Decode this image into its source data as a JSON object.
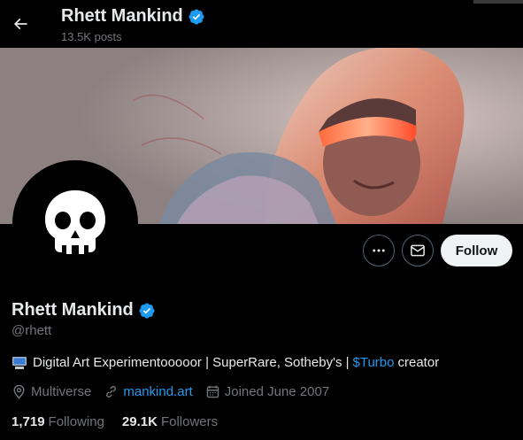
{
  "header": {
    "name": "Rhett Mankind",
    "posts": "13.5K posts"
  },
  "profile": {
    "name": "Rhett Mankind",
    "handle": "@rhett",
    "bio_text": "Digital Art Experimentooooor | SuperRare, Sotheby's |",
    "bio_link": "$Turbo",
    "bio_after": "creator",
    "location": "Multiverse",
    "website": "mankind.art",
    "joined": "Joined June 2007"
  },
  "actions": {
    "follow_label": "Follow"
  },
  "stats": {
    "following_count": "1,719",
    "following_label": "Following",
    "followers_count": "29.1K",
    "followers_label": "Followers"
  },
  "icons": {
    "back": "arrow-left-icon",
    "verified": "verified-badge-icon",
    "more": "more-horizontal-icon",
    "message": "envelope-icon",
    "location": "location-pin-icon",
    "link": "link-icon",
    "calendar": "calendar-icon",
    "bio_emoji": "computer-icon",
    "avatar": "skull-icon"
  },
  "colors": {
    "background": "#000000",
    "text": "#e7e9ea",
    "muted": "#71767b",
    "accent": "#1d9bf0",
    "follow_bg": "#eff3f4"
  }
}
